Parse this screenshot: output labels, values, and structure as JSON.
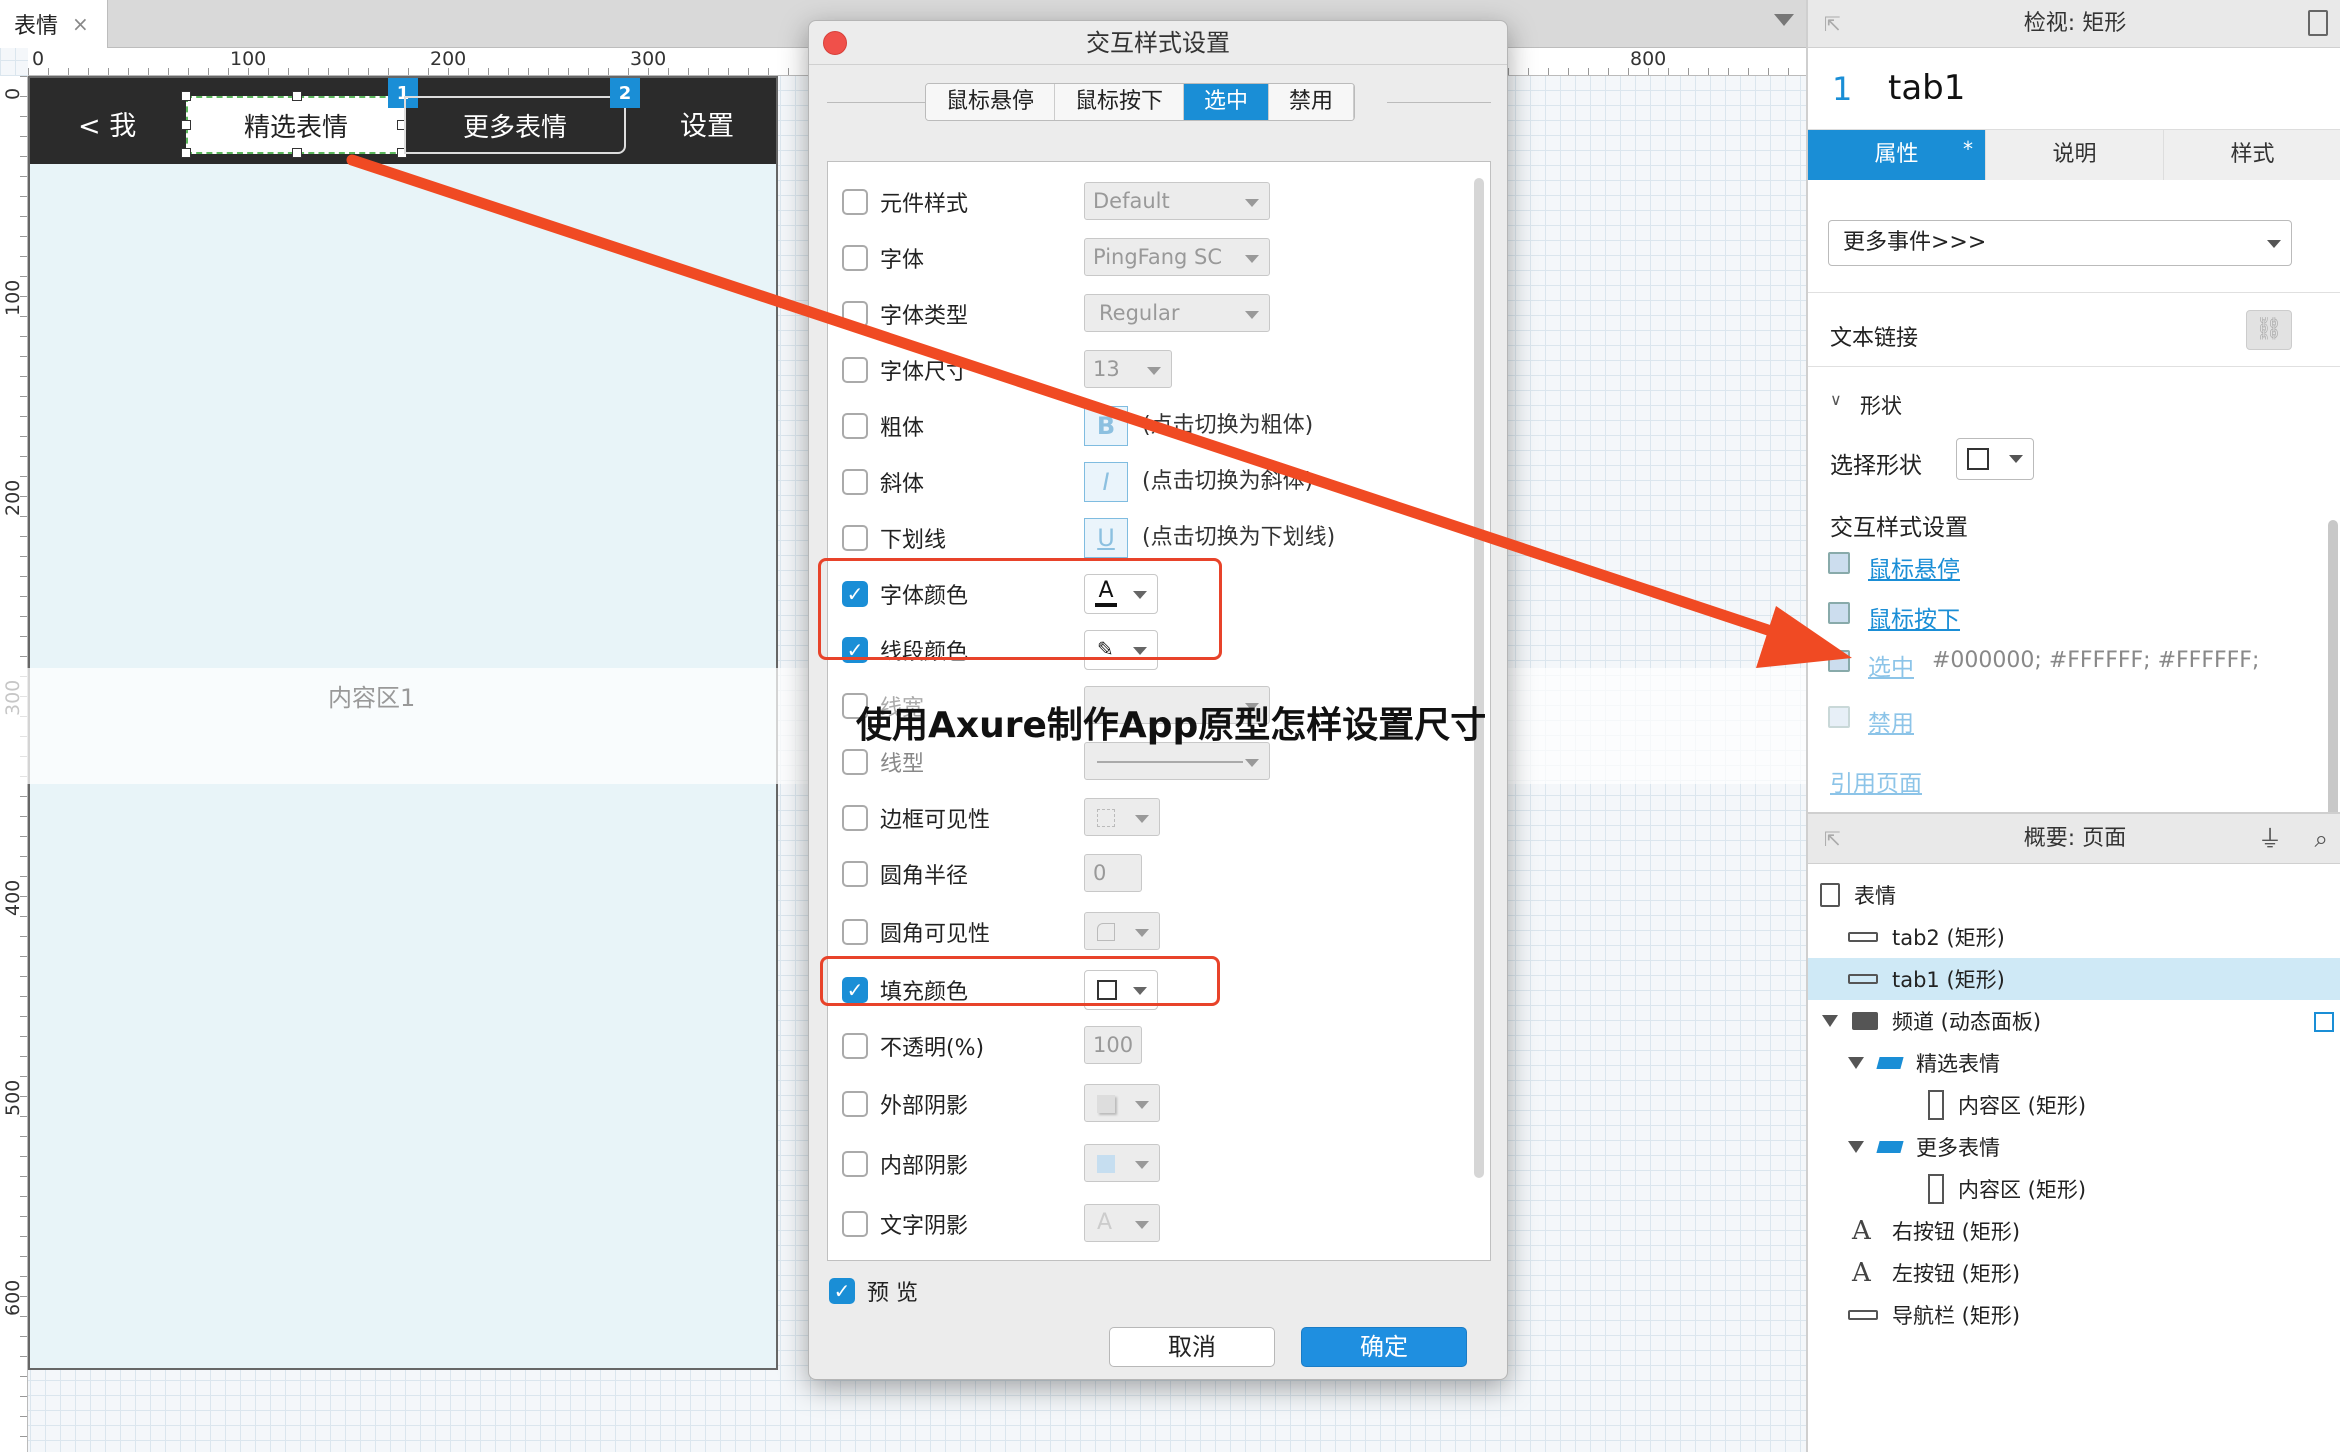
{
  "document_tab": {
    "label": "表情",
    "close": "×"
  },
  "ruler": {
    "h": [
      "0",
      "100",
      "200",
      "300",
      "800"
    ],
    "v": [
      "0",
      "100",
      "200",
      "300",
      "400",
      "500",
      "600"
    ]
  },
  "phone": {
    "nav_back": "< 我",
    "tab1_label": "精选表情",
    "tab2_label": "更多表情",
    "badge1": "1",
    "badge2": "2",
    "nav_settings": "设置",
    "content_label": "内容区1"
  },
  "banner": {
    "text": "使用Axure制作App原型怎样设置尺寸"
  },
  "dialog": {
    "title": "交互样式设置",
    "tabs": [
      "鼠标悬停",
      "鼠标按下",
      "选中",
      "禁用"
    ],
    "active_tab": "选中",
    "rows": [
      {
        "label": "元件样式",
        "checked": false,
        "control": "Default"
      },
      {
        "label": "字体",
        "checked": false,
        "control": "PingFang SC"
      },
      {
        "label": "字体类型",
        "checked": false,
        "control": "Regular"
      },
      {
        "label": "字体尺寸",
        "checked": false,
        "control": "13"
      },
      {
        "label": "粗体",
        "checked": false,
        "button": "B",
        "hint": "(点击切换为粗体)"
      },
      {
        "label": "斜体",
        "checked": false,
        "button": "I",
        "hint": "(点击切换为斜体)"
      },
      {
        "label": "下划线",
        "checked": false,
        "button": "U",
        "hint": "(点击切换为下划线)"
      },
      {
        "label": "字体颜色",
        "checked": true,
        "button": "A"
      },
      {
        "label": "线段颜色",
        "checked": true
      },
      {
        "label": "线宽",
        "checked": false
      },
      {
        "label": "线型",
        "checked": false
      },
      {
        "label": "边框可见性",
        "checked": false
      },
      {
        "label": "圆角半径",
        "checked": false,
        "control": "0"
      },
      {
        "label": "圆角可见性",
        "checked": false
      },
      {
        "label": "填充颜色",
        "checked": true
      },
      {
        "label": "不透明(%)",
        "checked": false,
        "control": "100"
      },
      {
        "label": "外部阴影",
        "checked": false
      },
      {
        "label": "内部阴影",
        "checked": false
      },
      {
        "label": "文字阴影",
        "checked": false,
        "button": "A"
      }
    ],
    "preview_label": "预 览",
    "preview_checked": true,
    "cancel": "取消",
    "ok": "确定"
  },
  "inspector": {
    "header": "检视: 矩形",
    "num": "1",
    "name": "tab1",
    "tabs": [
      "属性",
      "说明",
      "样式"
    ],
    "tab_marker": "*",
    "events_select": "更多事件>>>",
    "text_link": "文本链接",
    "shape_section": "形状",
    "select_shape": "选择形状",
    "interaction_title": "交互样式设置",
    "links": [
      "鼠标悬停",
      "鼠标按下",
      "选中",
      "禁用"
    ],
    "selected_values": "#000000; #FFFFFF; #FFFFFF;",
    "ref_page": "引用页面"
  },
  "outline": {
    "header": "概要: 页面",
    "items": [
      {
        "label": "表情",
        "icon": "page"
      },
      {
        "label": "tab2 (矩形)",
        "icon": "rect"
      },
      {
        "label": "tab1 (矩形)",
        "icon": "rect",
        "selected": true
      },
      {
        "label": "频道 (动态面板)",
        "icon": "panel"
      },
      {
        "label": "精选表情",
        "icon": "state"
      },
      {
        "label": "内容区 (矩形)",
        "icon": "vrect"
      },
      {
        "label": "更多表情",
        "icon": "state"
      },
      {
        "label": "内容区 (矩形)",
        "icon": "vrect"
      },
      {
        "label": "右按钮 (矩形)",
        "icon": "text"
      },
      {
        "label": "左按钮 (矩形)",
        "icon": "text"
      },
      {
        "label": "导航栏 (矩形)",
        "icon": "rect"
      }
    ]
  },
  "colors": {
    "accent": "#1a8ed6",
    "highlight": "#e8432a",
    "arrow": "#f04a23"
  }
}
